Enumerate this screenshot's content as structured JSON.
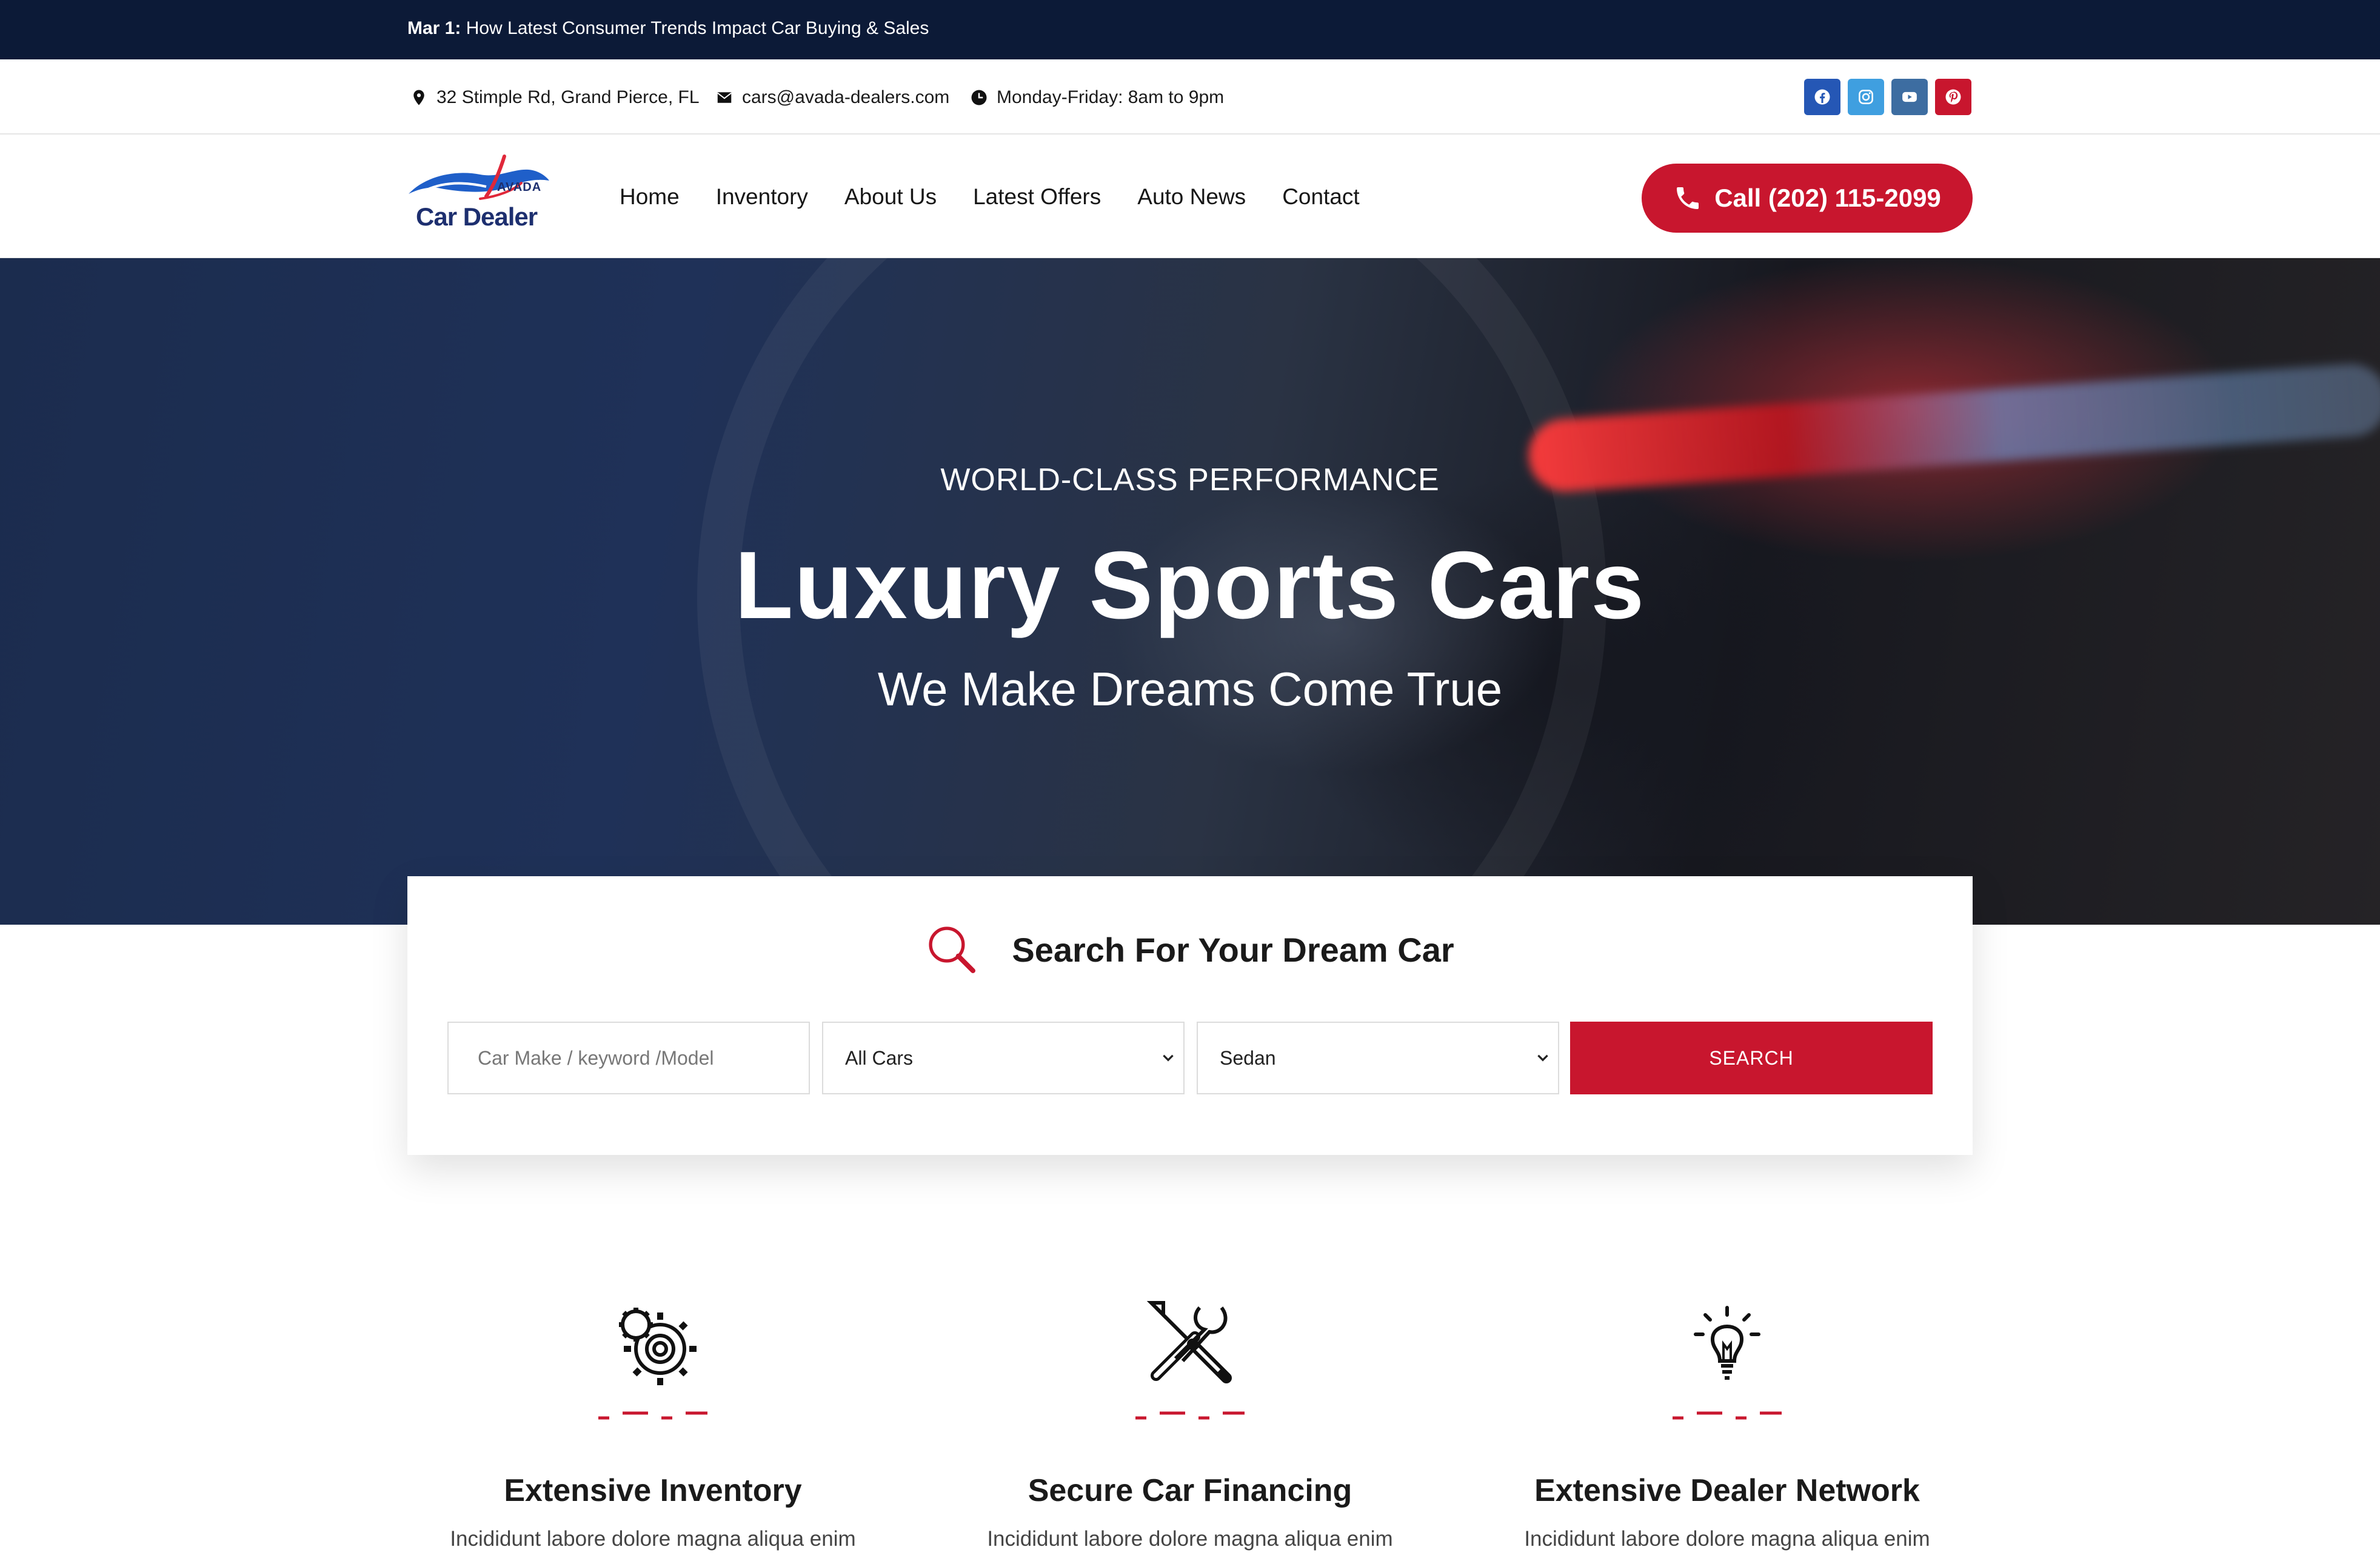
{
  "topbar": {
    "date": "Mar 1:",
    "headline": "How Latest Consumer Trends Impact Car Buying & Sales"
  },
  "info": {
    "address": "32 Stimple Rd, Grand Pierce, FL",
    "email": "cars@avada-dealers.com",
    "hours": "Monday-Friday: 8am to 9pm"
  },
  "social": [
    "facebook-icon",
    "instagram-icon",
    "youtube-icon",
    "pinterest-icon"
  ],
  "logo": {
    "top": "AVADA",
    "name": "Car Dealer"
  },
  "nav": [
    "Home",
    "Inventory",
    "About Us",
    "Latest Offers",
    "Auto News",
    "Contact"
  ],
  "call": {
    "label": "Call (202) 115-2099"
  },
  "hero": {
    "kicker": "WORLD-CLASS PERFORMANCE",
    "title": "Luxury Sports Cars",
    "subtitle": "We Make Dreams Come True"
  },
  "search": {
    "title": "Search For Your Dream Car",
    "placeholder": "Car Make / keyword /Model",
    "select1": "All Cars",
    "select2": "Sedan",
    "button": "SEARCH"
  },
  "features": [
    {
      "icon": "gears-icon",
      "title": "Extensive Inventory",
      "text": "Incididunt labore dolore magna aliqua enim"
    },
    {
      "icon": "tools-icon",
      "title": "Secure Car Financing",
      "text": "Incididunt labore dolore magna aliqua enim"
    },
    {
      "icon": "lightbulb-icon",
      "title": "Extensive Dealer Network",
      "text": "Incididunt labore dolore magna aliqua enim"
    }
  ],
  "colors": {
    "accent": "#c8162e",
    "navy": "#0c1a37",
    "brand_blue": "#1d2f6f"
  }
}
